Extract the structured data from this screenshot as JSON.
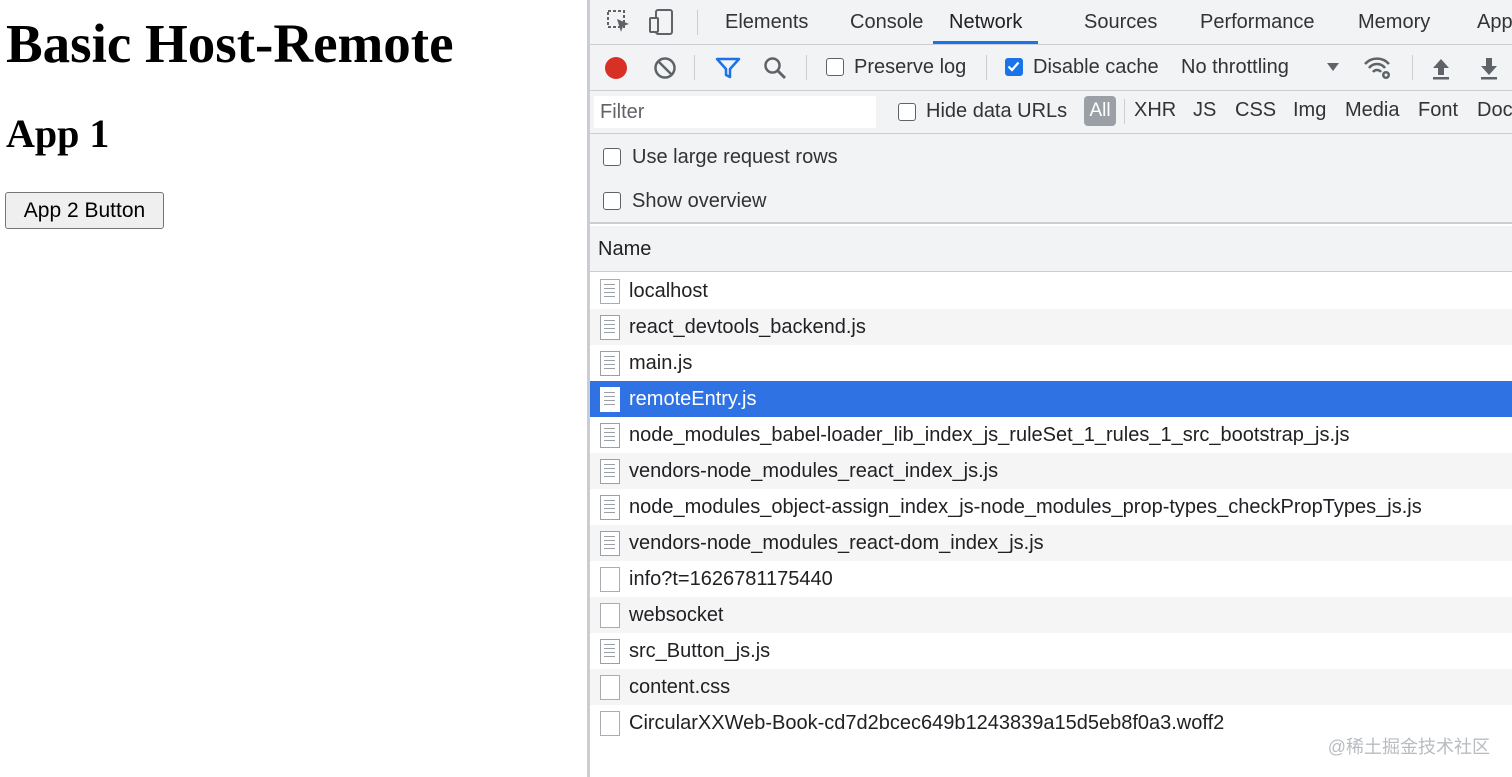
{
  "page": {
    "title": "Basic Host-Remote",
    "subtitle": "App 1",
    "button_label": "App 2 Button"
  },
  "devtools": {
    "tabs": [
      {
        "label": "Elements",
        "active": false
      },
      {
        "label": "Console",
        "active": false
      },
      {
        "label": "Network",
        "active": true
      },
      {
        "label": "Sources",
        "active": false
      },
      {
        "label": "Performance",
        "active": false
      },
      {
        "label": "Memory",
        "active": false
      },
      {
        "label": "App",
        "active": false
      }
    ],
    "toolbar": {
      "preserve_log_label": "Preserve log",
      "preserve_log_checked": false,
      "disable_cache_label": "Disable cache",
      "disable_cache_checked": true,
      "throttling_label": "No throttling"
    },
    "filter": {
      "placeholder": "Filter",
      "hide_data_urls_label": "Hide data URLs",
      "types": [
        "All",
        "XHR",
        "JS",
        "CSS",
        "Img",
        "Media",
        "Font",
        "Doc"
      ]
    },
    "options": {
      "large_rows_label": "Use large request rows",
      "overview_label": "Show overview"
    },
    "column_header": "Name",
    "requests": [
      {
        "name": "localhost",
        "icon": "document-icon"
      },
      {
        "name": "react_devtools_backend.js",
        "icon": "script-icon"
      },
      {
        "name": "main.js",
        "icon": "script-icon"
      },
      {
        "name": "remoteEntry.js",
        "icon": "script-icon",
        "selected": true
      },
      {
        "name": "node_modules_babel-loader_lib_index_js_ruleSet_1_rules_1_src_bootstrap_js.js",
        "icon": "script-icon"
      },
      {
        "name": "vendors-node_modules_react_index_js.js",
        "icon": "script-icon"
      },
      {
        "name": "node_modules_object-assign_index_js-node_modules_prop-types_checkPropTypes_js.js",
        "icon": "script-icon"
      },
      {
        "name": "vendors-node_modules_react-dom_index_js.js",
        "icon": "script-icon"
      },
      {
        "name": "info?t=1626781175440",
        "icon": "file-icon"
      },
      {
        "name": "websocket",
        "icon": "file-icon"
      },
      {
        "name": "src_Button_js.js",
        "icon": "script-icon"
      },
      {
        "name": "content.css",
        "icon": "file-icon"
      },
      {
        "name": "CircularXXWeb-Book-cd7d2bcec649b1243839a15d5eb8f0a3.woff2",
        "icon": "file-icon"
      }
    ]
  },
  "watermark": "@稀土掘金技术社区",
  "colors": {
    "accent": "#1a73e8",
    "selected_row": "#2f72e4",
    "record": "#d93025"
  }
}
